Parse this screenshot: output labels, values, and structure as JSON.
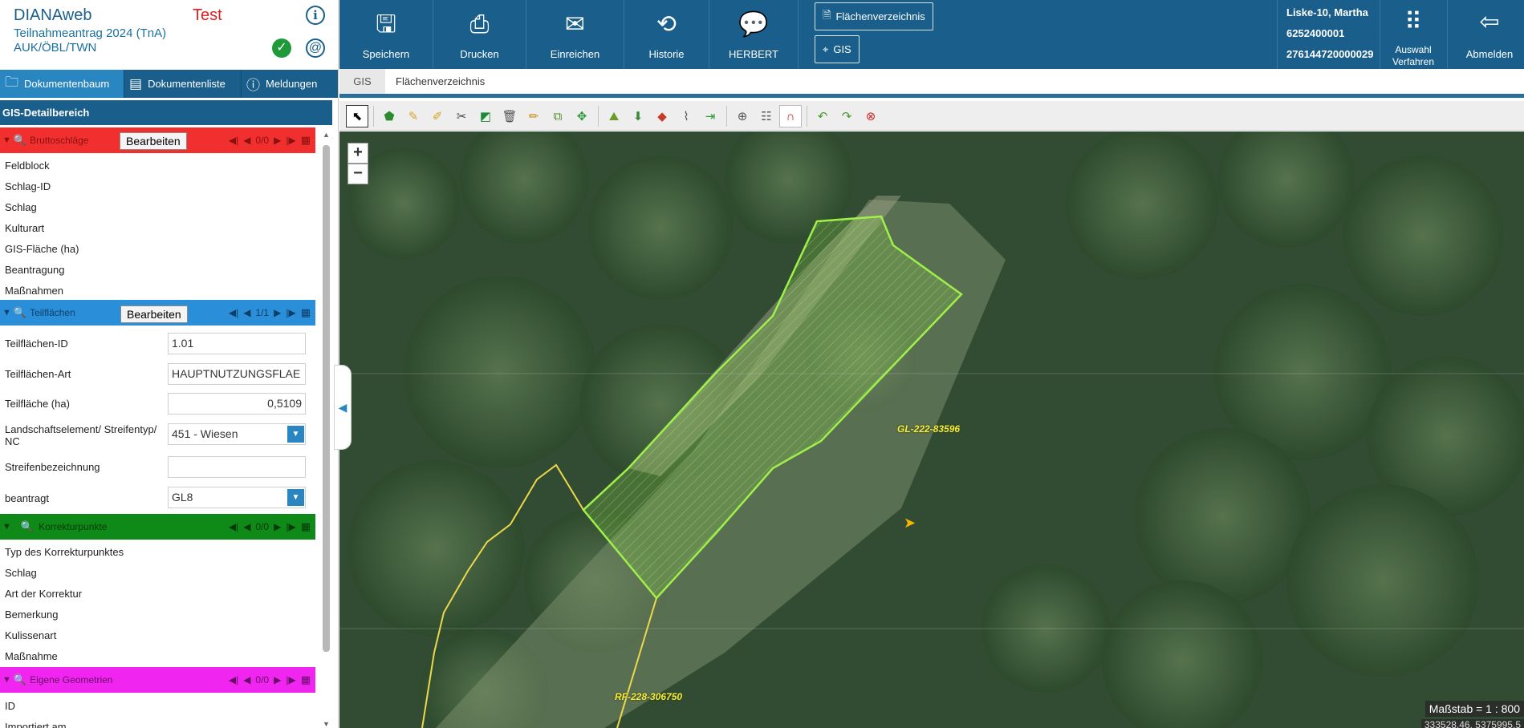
{
  "app": {
    "name": "DIANAweb",
    "env": "Test",
    "subtitle1": "Teilnahmeantrag 2024 (TnA)",
    "subtitle2": "AUK/ÖBL/TWN"
  },
  "left_tabs": [
    {
      "label": "Dokumentenbaum",
      "icon": "folder-icon",
      "active": true
    },
    {
      "label": "Dokumentenliste",
      "icon": "document-list-icon",
      "active": false
    },
    {
      "label": "Meldungen",
      "icon": "alert-circle-icon",
      "active": false
    }
  ],
  "gis_detail_title": "GIS-Detailbereich",
  "edit_label": "Bearbeiten",
  "sections": {
    "bruttoschlaege": {
      "title": "Bruttoschläge",
      "counter": "0/0",
      "color": "#f22f2f",
      "fields": [
        "Feldblock",
        "Schlag-ID",
        "Schlag",
        "Kulturart",
        "GIS-Fläche (ha)",
        "Beantragung",
        "Maßnahmen"
      ]
    },
    "teilflaechen": {
      "title": "Teilflächen",
      "counter": "1/1",
      "color": "#2a8fd8",
      "fields": [
        {
          "label": "Teilflächen-ID",
          "value": "1.01"
        },
        {
          "label": "Teilflächen-Art",
          "value": "HAUPTNUTZUNGSFLAE"
        },
        {
          "label": "Teilfläche (ha)",
          "value": "0,5109"
        },
        {
          "label": "Landschaftselement/ Streifentyp/ NC",
          "value": "451 - Wiesen"
        },
        {
          "label": "Streifenbezeichnung",
          "value": ""
        },
        {
          "label": "beantragt",
          "value": "GL8"
        }
      ]
    },
    "korrekturpunkte": {
      "title": "Korrekturpunkte",
      "counter": "0/0",
      "color": "#0f8a18",
      "fields": [
        "Typ des Korrekturpunktes",
        "Schlag",
        "Art der Korrektur",
        "Bemerkung",
        "Kulissenart",
        "Maßnahme"
      ]
    },
    "eigene": {
      "title": "Eigene Geometrien",
      "counter": "0/0",
      "color": "#f026f0",
      "fields": [
        "ID",
        "Importiert am"
      ]
    }
  },
  "toolbar_main": [
    {
      "label": "Speichern",
      "icon": "save-icon"
    },
    {
      "label": "Drucken",
      "icon": "printer-icon"
    },
    {
      "label": "Einreichen",
      "icon": "send-mail-icon"
    },
    {
      "label": "Historie",
      "icon": "history-icon"
    },
    {
      "label": "HERBERT",
      "icon": "chat-icon"
    }
  ],
  "sub_buttons": {
    "flaechen": "Flächenverzeichnis",
    "gis": "GIS"
  },
  "user": {
    "name": "Liske-10, Martha",
    "id1": "6252400001",
    "id2": "276144720000029"
  },
  "auswahl": {
    "line1": "Auswahl",
    "line2": "Verfahren"
  },
  "logout": "Abmelden",
  "breadcrumb": [
    "GIS",
    "Flächenverzeichnis"
  ],
  "map": {
    "parcel_labels": [
      "GL-222-83596",
      "RF-228-306750"
    ],
    "scale": "Maßstab = 1 : 800",
    "coords": "333528.46, 5375995.5",
    "zoom_in": "+",
    "zoom_out": "−",
    "colors": {
      "parcel_green": "#9ff04a",
      "parcel_yellow": "#ecd84a",
      "label": "#f2ef2c"
    }
  }
}
